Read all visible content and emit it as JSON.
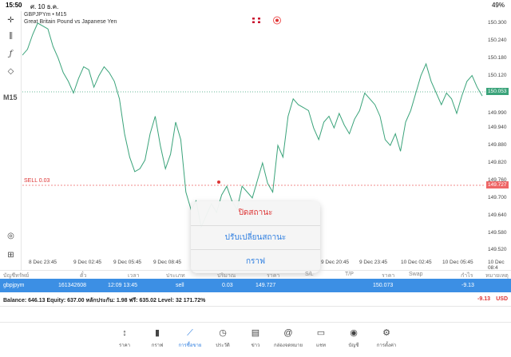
{
  "status": {
    "time": "15:50",
    "date": "ศ. 10 ธ.ค.",
    "battery": "49%"
  },
  "chart": {
    "symbol": "GBPJPYm • M15",
    "description": "Great Britain Pound vs Japanese Yen",
    "timeframe": "M15",
    "sell_label": "SELL 0.03",
    "current_price": "150.053",
    "sell_price": "149.727",
    "line_color": "#3aa37a",
    "y_ticks": [
      "150.300",
      "150.240",
      "150.180",
      "150.120",
      "150.053",
      "149.990",
      "149.940",
      "149.880",
      "149.820",
      "149.760",
      "149.727",
      "149.700",
      "149.640",
      "149.580",
      "149.520"
    ],
    "x_ticks": [
      "8 Dec 23:45",
      "9 Dec 02:45",
      "9 Dec 05:45",
      "9 Dec 08:45",
      "9 Dec 20:45",
      "9 Dec 23:45",
      "10 Dec 02:45",
      "10 Dec 05:45",
      "10 Dec 08:4"
    ]
  },
  "chart_data": {
    "type": "line",
    "ylim": [
      149.48,
      150.33
    ],
    "values": [
      150.19,
      150.21,
      150.26,
      150.3,
      150.29,
      150.28,
      150.22,
      150.18,
      150.13,
      150.1,
      150.06,
      150.11,
      150.15,
      150.14,
      150.08,
      150.12,
      150.15,
      150.13,
      150.1,
      150.04,
      149.92,
      149.84,
      149.79,
      149.8,
      149.83,
      149.92,
      149.98,
      149.88,
      149.8,
      149.85,
      149.96,
      149.9,
      149.72,
      149.66,
      149.69,
      149.6,
      149.64,
      149.68,
      149.65,
      149.71,
      149.74,
      149.69,
      149.66,
      149.74,
      149.72,
      149.7,
      149.76,
      149.82,
      149.75,
      149.72,
      149.88,
      149.84,
      149.98,
      150.04,
      150.02,
      150.01,
      150.0,
      149.94,
      149.9,
      149.96,
      149.98,
      149.94,
      149.99,
      149.95,
      149.92,
      149.97,
      150.0,
      150.06,
      150.04,
      150.02,
      149.98,
      149.9,
      149.88,
      149.92,
      149.86,
      149.96,
      150.0,
      150.06,
      150.12,
      150.16,
      150.1,
      150.06,
      150.02,
      150.06,
      150.04,
      149.99,
      150.05,
      150.1,
      150.12,
      150.08,
      150.05
    ]
  },
  "menu": {
    "close": "ปิดสถานะ",
    "modify": "ปรับเปลี่ยนสถานะ",
    "chart": "กราฟ"
  },
  "table": {
    "headers": [
      "บัญชีทรัพย์",
      "ตั๋ว",
      "เวลา",
      "ประเภท",
      "ปริมาณ",
      "ราคา",
      "S/L",
      "T/P",
      "ราคา",
      "Swap",
      "กำไร",
      "หมายเหตุ"
    ],
    "row": {
      "symbol": "gbpjpym",
      "ticket": "161342608",
      "time": "12:09 13:45",
      "type": "sell",
      "volume": "0.03",
      "price": "149.727",
      "current": "150.073",
      "profit": "-9.13"
    }
  },
  "balance": {
    "text": "Balance: 646.13 Equity: 637.00 หลักประกัน: 1.98 ฟรี: 635.02 Level: 32 171.72%",
    "profit": "-9.13",
    "currency": "USD"
  },
  "tabs": [
    {
      "label": "ราคา",
      "icon": "↕"
    },
    {
      "label": "กราฟ",
      "icon": "▮"
    },
    {
      "label": "การซื้อขาย",
      "icon": "⟋"
    },
    {
      "label": "ประวัติ",
      "icon": "◷"
    },
    {
      "label": "ข่าว",
      "icon": "▤"
    },
    {
      "label": "กล่องจดหมาย",
      "icon": "@"
    },
    {
      "label": "แชท",
      "icon": "▭"
    },
    {
      "label": "บัญชี",
      "icon": "◉"
    },
    {
      "label": "การตั้งค่า",
      "icon": "⚙"
    }
  ]
}
